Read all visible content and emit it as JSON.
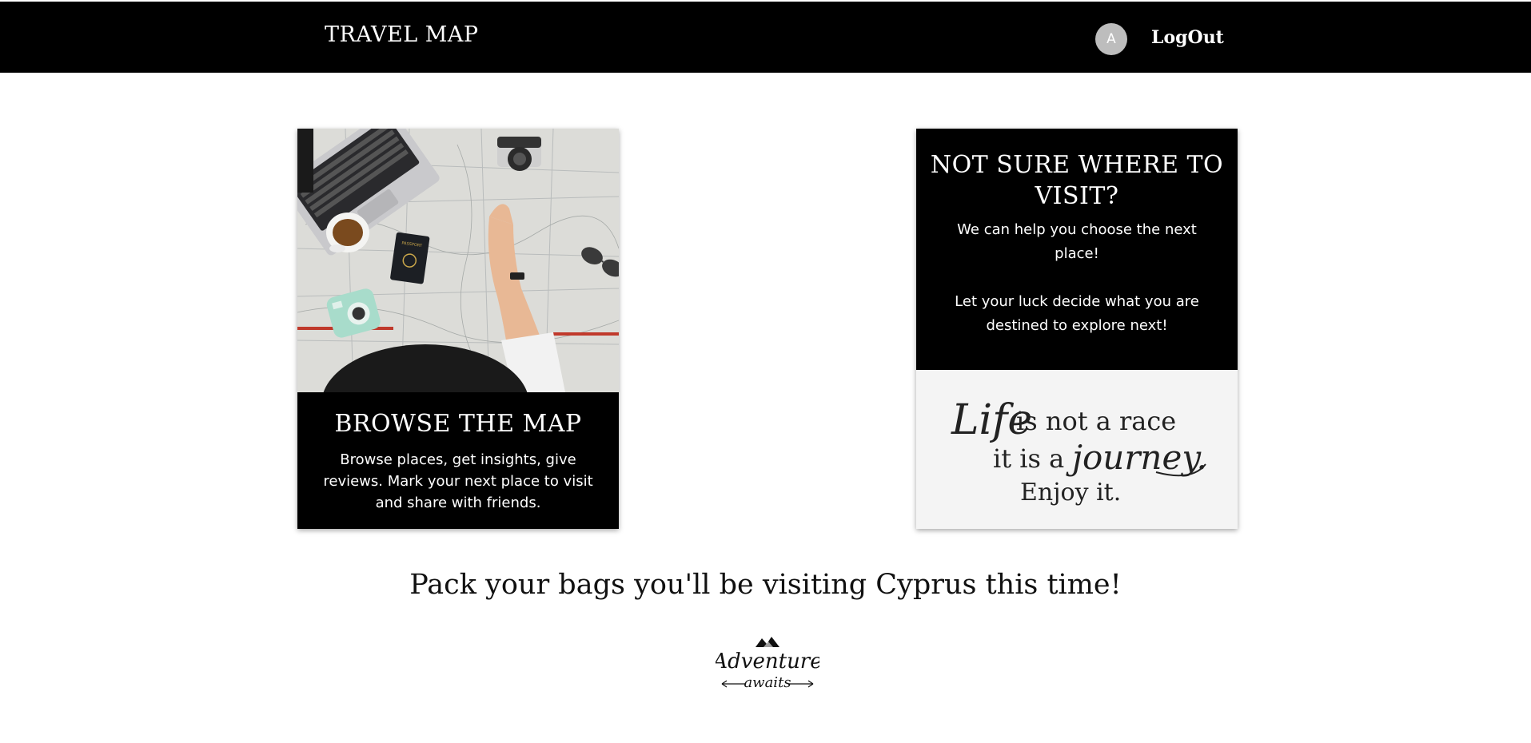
{
  "navbar": {
    "brand": "TRAVEL MAP",
    "avatar_initial": "A",
    "logout_label": "LogOut"
  },
  "browse_card": {
    "title": "BROWSE THE MAP",
    "text": "Browse places, get insights, give reviews. Mark your next place to visit and share with friends.",
    "photo_labels": {
      "passport": "PASSPORT"
    }
  },
  "random_card": {
    "title": "NOT SURE WHERE TO VISIT?",
    "text_1": "We can help you choose the next place!",
    "text_2": "Let your luck decide what you are destined to explore next!",
    "quote": {
      "line1_script": "Life",
      "line1_rest": "is not a race",
      "line2_prefix": "it is a",
      "line2_script": "journey.",
      "line3": "Enjoy it."
    }
  },
  "result_text": "Pack your bags you'll be visiting Cyprus this time!",
  "logo": {
    "line1": "Adventure",
    "line2": "awaits"
  },
  "colors": {
    "navbar_bg": "#000000",
    "card_bg": "#000000",
    "quote_bg": "#f4f4f4",
    "avatar_bg": "#bdbdbd"
  }
}
